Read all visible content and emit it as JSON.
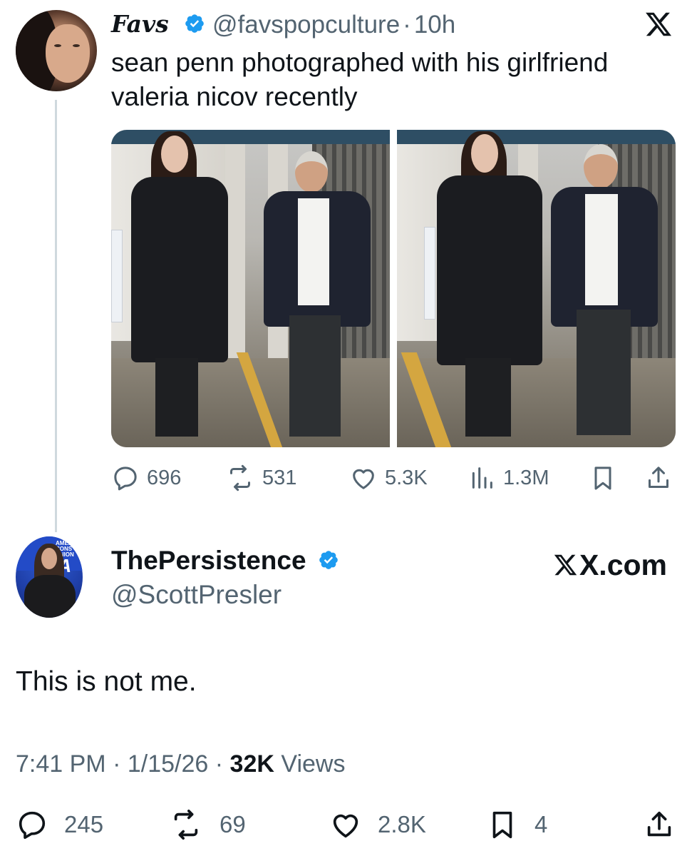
{
  "quoted_tweet": {
    "display_name": "Favs",
    "handle": "@favspopculture",
    "separator": "·",
    "time": "10h",
    "text": "sean penn photographed with his girlfriend valeria nicov recently",
    "stats": {
      "replies": "696",
      "reposts": "531",
      "likes": "5.3K",
      "views": "1.3M"
    },
    "icons": [
      "verified-badge-icon",
      "x-logo-icon",
      "reply-icon",
      "repost-icon",
      "like-icon",
      "views-icon",
      "bookmark-icon",
      "share-icon"
    ]
  },
  "main_tweet": {
    "display_name": "ThePersistence",
    "handle": "@ScottPresler",
    "watermark": "X.com",
    "text": "This is not me.",
    "time": "7:41 PM",
    "date": "1/15/26",
    "separator": "·",
    "views_count": "32K",
    "views_label": "Views",
    "stats": {
      "replies": "245",
      "reposts": "69",
      "likes": "2.8K",
      "bookmarks": "4"
    },
    "avatar_logo_text": "AMERICAN CONSERVATIVE UNION CPAC"
  },
  "colors": {
    "text": "#0f1419",
    "secondary": "#536471",
    "verified": "#1d9bf0",
    "thread_line": "#cfd9de"
  }
}
